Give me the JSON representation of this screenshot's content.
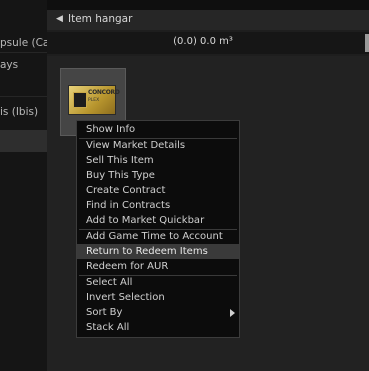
{
  "sidebar": {
    "items": [
      {
        "label": "psule (Ca"
      },
      {
        "label": "ays"
      },
      {
        "label": "is (Ibis)"
      },
      {
        "label": ""
      }
    ]
  },
  "window": {
    "title": "Item hangar",
    "volume": "(0.0) 0.0 m³"
  },
  "item": {
    "logo": "CONCORD",
    "sub": "PLEX"
  },
  "context_menu": {
    "items": [
      {
        "label": "Show Info"
      },
      {
        "label": "View Market Details"
      },
      {
        "label": "Sell This Item"
      },
      {
        "label": "Buy This Type"
      },
      {
        "label": "Create Contract"
      },
      {
        "label": "Find in Contracts"
      },
      {
        "label": "Add to Market Quickbar"
      },
      {
        "label": "Add Game Time to Account"
      },
      {
        "label": "Return to Redeem Items"
      },
      {
        "label": "Redeem for AUR"
      },
      {
        "label": "Select All"
      },
      {
        "label": "Invert Selection"
      },
      {
        "label": "Sort By"
      },
      {
        "label": "Stack All"
      }
    ]
  }
}
